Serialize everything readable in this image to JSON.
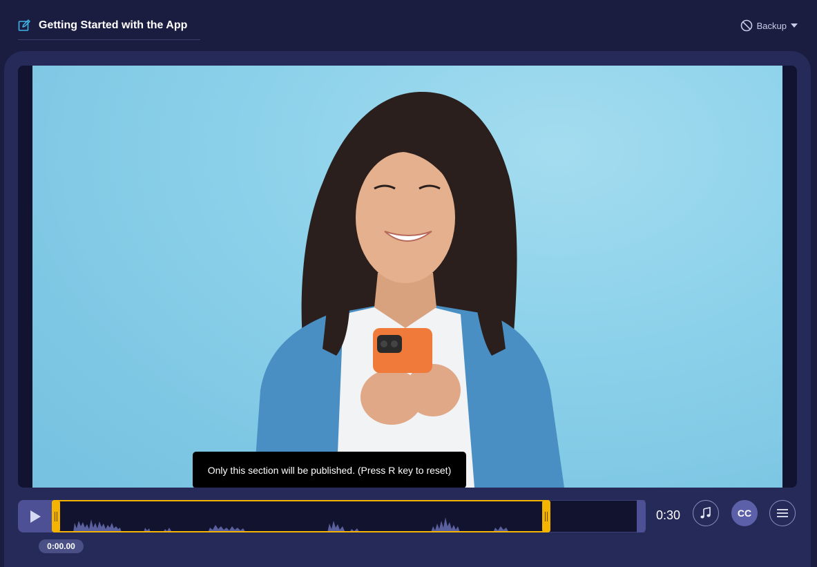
{
  "header": {
    "title": "Getting Started with the App",
    "backup_label": "Backup"
  },
  "video": {
    "tooltip": "Only this section will be published. (Press R key to reset)"
  },
  "timeline": {
    "duration": "0:30",
    "current_time": "0:00.00",
    "cc_label": "CC"
  },
  "colors": {
    "background": "#1b1d40",
    "panel": "#262a58",
    "accent_selection": "#f4b400",
    "accent_icon": "#3fb6e8"
  },
  "icons": [
    "edit-icon",
    "ban-icon",
    "play-icon",
    "music-note-icon",
    "menu-icon"
  ]
}
